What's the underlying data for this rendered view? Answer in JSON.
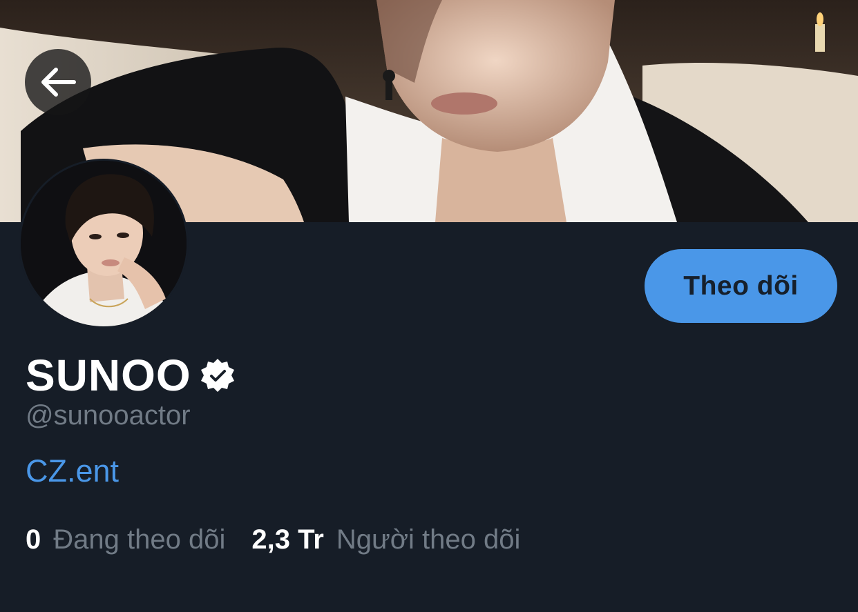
{
  "header": {
    "back_icon": "arrow-left-icon",
    "banner_image": "profile-banner-photo"
  },
  "profile": {
    "avatar": "profile-avatar-photo",
    "display_name": "SUNOO",
    "verified_icon": "verified-badge-icon",
    "handle": "@sunooactor",
    "bio": "CZ.ent",
    "follow_label": "Theo dõi"
  },
  "stats": {
    "following_count": "0",
    "following_label": "Đang theo dõi",
    "followers_count": "2,3 Tr",
    "followers_label": "Người theo dõi"
  },
  "colors": {
    "background": "#161d27",
    "accent": "#4a97e8",
    "muted_text": "#717b86",
    "primary_text": "#ffffff"
  }
}
